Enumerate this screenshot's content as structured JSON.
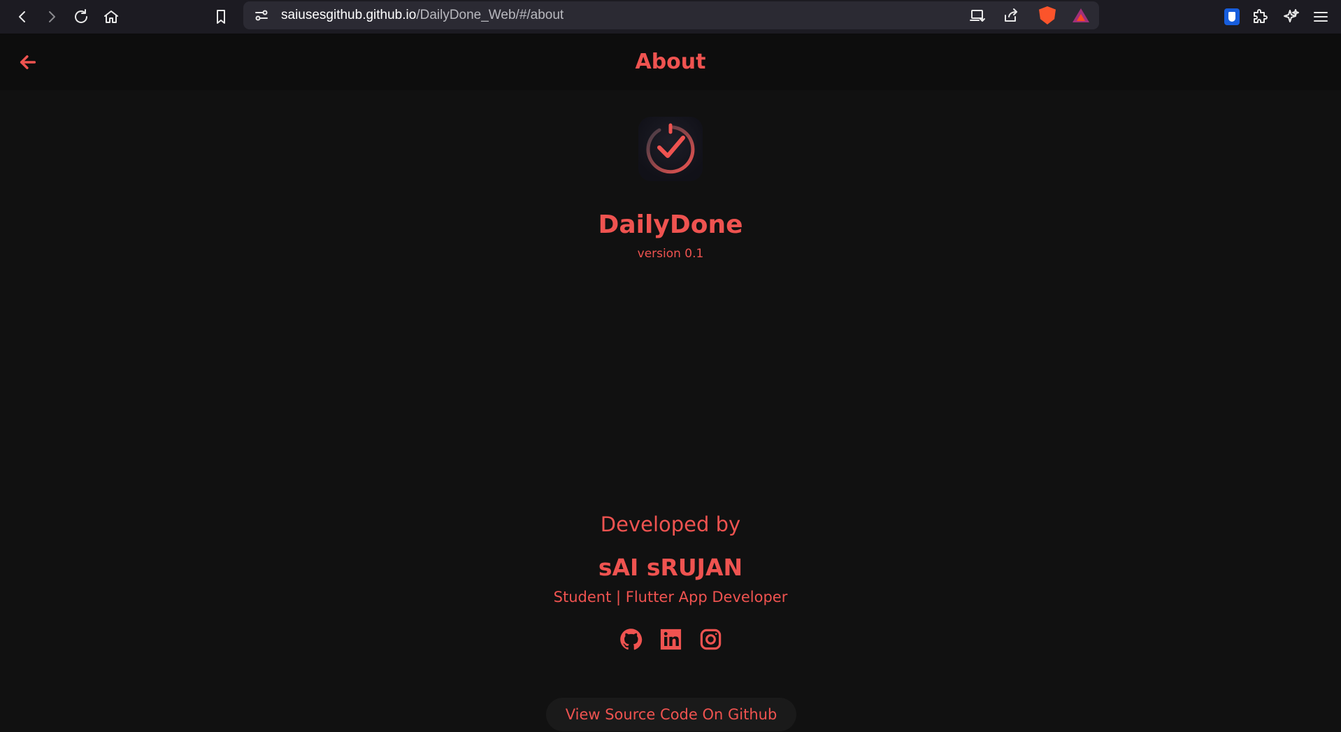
{
  "browser": {
    "url_host": "saiusesgithub.github.io",
    "url_path": "/DailyDone_Web/#/about"
  },
  "header": {
    "title": "About"
  },
  "app": {
    "name": "DailyDone",
    "version": "version 0.1"
  },
  "developer": {
    "heading": "Developed by",
    "name": "sAI sRUJAN",
    "role": "Student | Flutter App Developer"
  },
  "socials": [
    "github-icon",
    "linkedin-icon",
    "instagram-icon"
  ],
  "source_button": {
    "label": "View Source Code On Github"
  },
  "colors": {
    "accent": "#ef5350",
    "background": "#111111",
    "header_bg": "#0d0d0d",
    "button_bg": "#1a1a1a"
  }
}
